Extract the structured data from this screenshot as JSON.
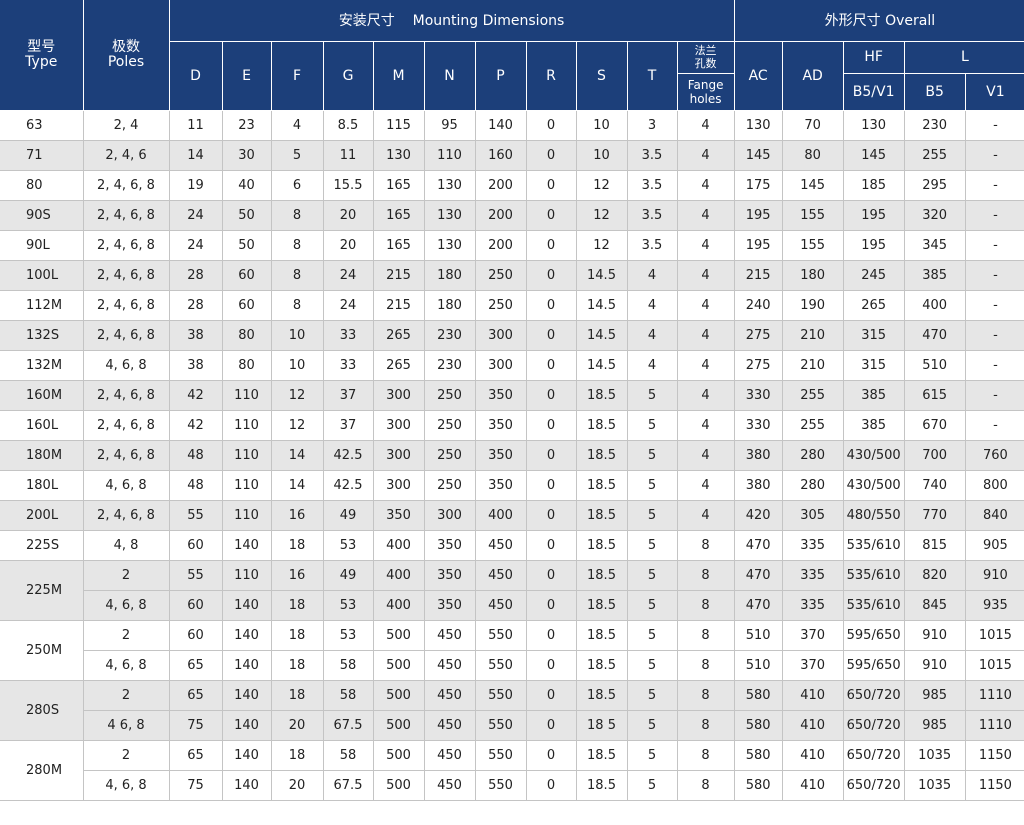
{
  "header": {
    "type_cn": "型号",
    "type_en": "Type",
    "poles_cn": "极数",
    "poles_en": "Poles",
    "mounting_group": "安装尺寸    Mounting Dimensions",
    "overall_group": "外形尺寸 Overall",
    "cols": [
      "D",
      "E",
      "F",
      "G",
      "M",
      "N",
      "P",
      "R",
      "S",
      "T"
    ],
    "flange_cn_1": "法兰",
    "flange_cn_2": "孔数",
    "flange_en_1": "Fange",
    "flange_en_2": "holes",
    "ac": "AC",
    "ad": "AD",
    "hf": "HF",
    "l": "L",
    "hf_sub": "B5/V1",
    "l_b5": "B5",
    "l_v1": "V1"
  },
  "groups": [
    {
      "type": "63",
      "rows": [
        {
          "poles": "2, 4",
          "D": "11",
          "E": "23",
          "F": "4",
          "G": "8.5",
          "M": "115",
          "N": "95",
          "P": "140",
          "R": "0",
          "S": "10",
          "T": "3",
          "holes": "4",
          "AC": "130",
          "AD": "70",
          "HF": "130",
          "B5": "230",
          "V1": "-"
        }
      ]
    },
    {
      "type": "71",
      "rows": [
        {
          "poles": "2, 4, 6",
          "D": "14",
          "E": "30",
          "F": "5",
          "G": "11",
          "M": "130",
          "N": "110",
          "P": "160",
          "R": "0",
          "S": "10",
          "T": "3.5",
          "holes": "4",
          "AC": "145",
          "AD": "80",
          "HF": "145",
          "B5": "255",
          "V1": "-"
        }
      ]
    },
    {
      "type": "80",
      "rows": [
        {
          "poles": "2, 4, 6, 8",
          "D": "19",
          "E": "40",
          "F": "6",
          "G": "15.5",
          "M": "165",
          "N": "130",
          "P": "200",
          "R": "0",
          "S": "12",
          "T": "3.5",
          "holes": "4",
          "AC": "175",
          "AD": "145",
          "HF": "185",
          "B5": "295",
          "V1": "-"
        }
      ]
    },
    {
      "type": "90S",
      "rows": [
        {
          "poles": "2, 4, 6, 8",
          "D": "24",
          "E": "50",
          "F": "8",
          "G": "20",
          "M": "165",
          "N": "130",
          "P": "200",
          "R": "0",
          "S": "12",
          "T": "3.5",
          "holes": "4",
          "AC": "195",
          "AD": "155",
          "HF": "195",
          "B5": "320",
          "V1": "-"
        }
      ]
    },
    {
      "type": "90L",
      "rows": [
        {
          "poles": "2, 4, 6, 8",
          "D": "24",
          "E": "50",
          "F": "8",
          "G": "20",
          "M": "165",
          "N": "130",
          "P": "200",
          "R": "0",
          "S": "12",
          "T": "3.5",
          "holes": "4",
          "AC": "195",
          "AD": "155",
          "HF": "195",
          "B5": "345",
          "V1": "-"
        }
      ]
    },
    {
      "type": "100L",
      "rows": [
        {
          "poles": "2, 4, 6, 8",
          "D": "28",
          "E": "60",
          "F": "8",
          "G": "24",
          "M": "215",
          "N": "180",
          "P": "250",
          "R": "0",
          "S": "14.5",
          "T": "4",
          "holes": "4",
          "AC": "215",
          "AD": "180",
          "HF": "245",
          "B5": "385",
          "V1": "-"
        }
      ]
    },
    {
      "type": "112M",
      "rows": [
        {
          "poles": "2, 4, 6, 8",
          "D": "28",
          "E": "60",
          "F": "8",
          "G": "24",
          "M": "215",
          "N": "180",
          "P": "250",
          "R": "0",
          "S": "14.5",
          "T": "4",
          "holes": "4",
          "AC": "240",
          "AD": "190",
          "HF": "265",
          "B5": "400",
          "V1": "-"
        }
      ]
    },
    {
      "type": "132S",
      "rows": [
        {
          "poles": "2, 4, 6, 8",
          "D": "38",
          "E": "80",
          "F": "10",
          "G": "33",
          "M": "265",
          "N": "230",
          "P": "300",
          "R": "0",
          "S": "14.5",
          "T": "4",
          "holes": "4",
          "AC": "275",
          "AD": "210",
          "HF": "315",
          "B5": "470",
          "V1": "-"
        }
      ]
    },
    {
      "type": "132M",
      "rows": [
        {
          "poles": "4, 6, 8",
          "D": "38",
          "E": "80",
          "F": "10",
          "G": "33",
          "M": "265",
          "N": "230",
          "P": "300",
          "R": "0",
          "S": "14.5",
          "T": "4",
          "holes": "4",
          "AC": "275",
          "AD": "210",
          "HF": "315",
          "B5": "510",
          "V1": "-"
        }
      ]
    },
    {
      "type": "160M",
      "rows": [
        {
          "poles": "2, 4, 6, 8",
          "D": "42",
          "E": "110",
          "F": "12",
          "G": "37",
          "M": "300",
          "N": "250",
          "P": "350",
          "R": "0",
          "S": "18.5",
          "T": "5",
          "holes": "4",
          "AC": "330",
          "AD": "255",
          "HF": "385",
          "B5": "615",
          "V1": "-"
        }
      ]
    },
    {
      "type": "160L",
      "rows": [
        {
          "poles": "2, 4, 6, 8",
          "D": "42",
          "E": "110",
          "F": "12",
          "G": "37",
          "M": "300",
          "N": "250",
          "P": "350",
          "R": "0",
          "S": "18.5",
          "T": "5",
          "holes": "4",
          "AC": "330",
          "AD": "255",
          "HF": "385",
          "B5": "670",
          "V1": "-"
        }
      ]
    },
    {
      "type": "180M",
      "rows": [
        {
          "poles": "2, 4, 6, 8",
          "D": "48",
          "E": "110",
          "F": "14",
          "G": "42.5",
          "M": "300",
          "N": "250",
          "P": "350",
          "R": "0",
          "S": "18.5",
          "T": "5",
          "holes": "4",
          "AC": "380",
          "AD": "280",
          "HF": "430/500",
          "B5": "700",
          "V1": "760"
        }
      ]
    },
    {
      "type": "180L",
      "rows": [
        {
          "poles": "4, 6, 8",
          "D": "48",
          "E": "110",
          "F": "14",
          "G": "42.5",
          "M": "300",
          "N": "250",
          "P": "350",
          "R": "0",
          "S": "18.5",
          "T": "5",
          "holes": "4",
          "AC": "380",
          "AD": "280",
          "HF": "430/500",
          "B5": "740",
          "V1": "800"
        }
      ]
    },
    {
      "type": "200L",
      "rows": [
        {
          "poles": "2, 4, 6, 8",
          "D": "55",
          "E": "110",
          "F": "16",
          "G": "49",
          "M": "350",
          "N": "300",
          "P": "400",
          "R": "0",
          "S": "18.5",
          "T": "5",
          "holes": "4",
          "AC": "420",
          "AD": "305",
          "HF": "480/550",
          "B5": "770",
          "V1": "840"
        }
      ]
    },
    {
      "type": "225S",
      "rows": [
        {
          "poles": "4, 8",
          "D": "60",
          "E": "140",
          "F": "18",
          "G": "53",
          "M": "400",
          "N": "350",
          "P": "450",
          "R": "0",
          "S": "18.5",
          "T": "5",
          "holes": "8",
          "AC": "470",
          "AD": "335",
          "HF": "535/610",
          "B5": "815",
          "V1": "905"
        }
      ]
    },
    {
      "type": "225M",
      "rows": [
        {
          "poles": "2",
          "D": "55",
          "E": "110",
          "F": "16",
          "G": "49",
          "M": "400",
          "N": "350",
          "P": "450",
          "R": "0",
          "S": "18.5",
          "T": "5",
          "holes": "8",
          "AC": "470",
          "AD": "335",
          "HF": "535/610",
          "B5": "820",
          "V1": "910"
        },
        {
          "poles": "4, 6, 8",
          "D": "60",
          "E": "140",
          "F": "18",
          "G": "53",
          "M": "400",
          "N": "350",
          "P": "450",
          "R": "0",
          "S": "18.5",
          "T": "5",
          "holes": "8",
          "AC": "470",
          "AD": "335",
          "HF": "535/610",
          "B5": "845",
          "V1": "935"
        }
      ]
    },
    {
      "type": "250M",
      "rows": [
        {
          "poles": "2",
          "D": "60",
          "E": "140",
          "F": "18",
          "G": "53",
          "M": "500",
          "N": "450",
          "P": "550",
          "R": "0",
          "S": "18.5",
          "T": "5",
          "holes": "8",
          "AC": "510",
          "AD": "370",
          "HF": "595/650",
          "B5": "910",
          "V1": "1015"
        },
        {
          "poles": "4, 6, 8",
          "D": "65",
          "E": "140",
          "F": "18",
          "G": "58",
          "M": "500",
          "N": "450",
          "P": "550",
          "R": "0",
          "S": "18.5",
          "T": "5",
          "holes": "8",
          "AC": "510",
          "AD": "370",
          "HF": "595/650",
          "B5": "910",
          "V1": "1015"
        }
      ]
    },
    {
      "type": "280S",
      "rows": [
        {
          "poles": "2",
          "D": "65",
          "E": "140",
          "F": "18",
          "G": "58",
          "M": "500",
          "N": "450",
          "P": "550",
          "R": "0",
          "S": "18.5",
          "T": "5",
          "holes": "8",
          "AC": "580",
          "AD": "410",
          "HF": "650/720",
          "B5": "985",
          "V1": "1110"
        },
        {
          "poles": "4 6, 8",
          "D": "75",
          "E": "140",
          "F": "20",
          "G": "67.5",
          "M": "500",
          "N": "450",
          "P": "550",
          "R": "0",
          "S": "18 5",
          "T": "5",
          "holes": "8",
          "AC": "580",
          "AD": "410",
          "HF": "650/720",
          "B5": "985",
          "V1": "1110"
        }
      ]
    },
    {
      "type": "280M",
      "rows": [
        {
          "poles": "2",
          "D": "65",
          "E": "140",
          "F": "18",
          "G": "58",
          "M": "500",
          "N": "450",
          "P": "550",
          "R": "0",
          "S": "18.5",
          "T": "5",
          "holes": "8",
          "AC": "580",
          "AD": "410",
          "HF": "650/720",
          "B5": "1035",
          "V1": "1150"
        },
        {
          "poles": "4, 6, 8",
          "D": "75",
          "E": "140",
          "F": "20",
          "G": "67.5",
          "M": "500",
          "N": "450",
          "P": "550",
          "R": "0",
          "S": "18.5",
          "T": "5",
          "holes": "8",
          "AC": "580",
          "AD": "410",
          "HF": "650/720",
          "B5": "1035",
          "V1": "1150"
        }
      ]
    }
  ],
  "colors": {
    "header_bg": "#1c3f7a",
    "header_text": "#ffffff",
    "row_shade": "#e6e6e6",
    "row_plain": "#ffffff",
    "grid": "#c4c4c4"
  }
}
